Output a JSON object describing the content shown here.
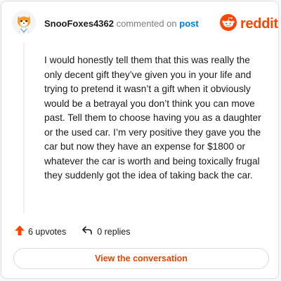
{
  "header": {
    "username": "SnooFoxes4362",
    "action_text": "commented on",
    "post_link": "post",
    "avatar_icon": "snoo-fox-avatar-icon",
    "brand_icon": "reddit-alien-icon",
    "brand_name": "reddit"
  },
  "comment": {
    "body": "I would honestly tell them that this was really the only decent gift they’ve given you in your life and trying to pretend it wasn’t a gift when it obviously would be a betrayal you don’t think you can move past. Tell them to choose having you as a daughter or the used car. I’m very positive they gave you the car but now they have an expense for $1800 or whatever the car is worth and being toxically frugal they suddenly got the idea of taking back the car."
  },
  "actions": {
    "upvotes_label": "6 upvotes",
    "replies_label": "0 replies",
    "upvote_icon": "upvote-arrow-icon",
    "reply_icon": "reply-arrow-icon"
  },
  "cta": {
    "label": "View the conversation"
  },
  "colors": {
    "brand": "#ff4500",
    "link": "#0079d3",
    "cta_text": "#e54503",
    "text": "#1a1a1b",
    "muted": "#7c7c7c",
    "border": "#dcdfe2"
  }
}
